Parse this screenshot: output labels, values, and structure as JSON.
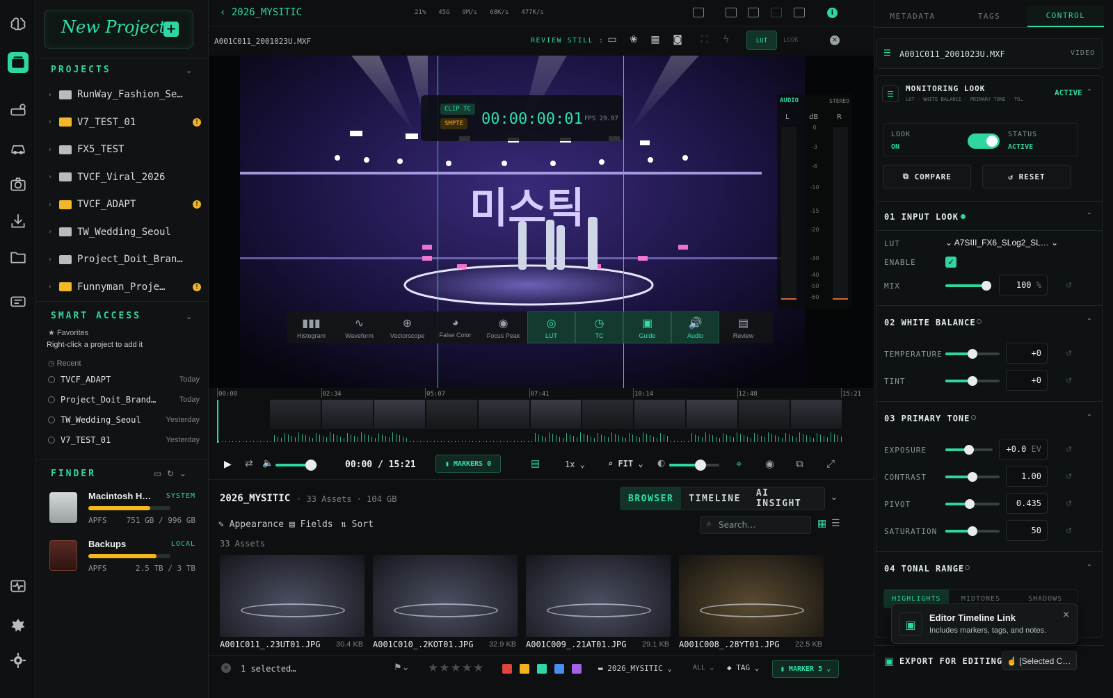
{
  "rail": {
    "icons": [
      "brain-icon",
      "stack-icon",
      "devices-icon",
      "car-icon",
      "camera-icon",
      "import-icon",
      "folder-question-icon",
      "chat-list-icon",
      "pulse-icon",
      "plugin-icon",
      "settings-icon"
    ]
  },
  "sidebar": {
    "new_project": "New Project",
    "projects_title": "PROJECTS",
    "projects": [
      {
        "name": "RunWay_Fashion_Se…",
        "color": "gray",
        "warn": false
      },
      {
        "name": "V7_TEST_01",
        "color": "yellow",
        "warn": true
      },
      {
        "name": "FX5_TEST",
        "color": "gray",
        "warn": false
      },
      {
        "name": "TVCF_Viral_2026",
        "color": "gray",
        "warn": false
      },
      {
        "name": "TVCF_ADAPT",
        "color": "yellow",
        "warn": true
      },
      {
        "name": "TW_Wedding_Seoul",
        "color": "gray",
        "warn": false
      },
      {
        "name": "Project_Doit_Bran…",
        "color": "gray",
        "warn": false
      },
      {
        "name": "Funnyman_Proje…",
        "color": "yellow",
        "warn": true
      }
    ],
    "warn_glyph": "!",
    "smart_title": "SMART ACCESS",
    "favorites": "Favorites",
    "favorites_hint": "Right-click a project to add it",
    "recent_title": "Recent",
    "recent": [
      {
        "name": "TVCF_ADAPT",
        "when": "Today"
      },
      {
        "name": "Project_Doit_Brand…",
        "when": "Today"
      },
      {
        "name": "TW_Wedding_Seoul",
        "when": "Yesterday"
      },
      {
        "name": "V7_TEST_01",
        "when": "Yesterday"
      }
    ],
    "finder_title": "FINDER",
    "disks": [
      {
        "name": "Macintosh H…",
        "tag": "SYSTEM",
        "fs": "APFS",
        "size": "751 GB / 996 GB",
        "fill": 0.754
      },
      {
        "name": "Backups",
        "tag": "LOCAL",
        "fs": "APFS",
        "size": "2.5 TB / 3 TB",
        "fill": 0.83
      }
    ]
  },
  "topbar": {
    "title": "2026_MYSITIC",
    "stats": [
      "21%",
      "45G",
      "9M/s",
      "68K/s",
      "477K/s"
    ]
  },
  "toolbar2": {
    "filename": "A001C011_2001023U.MXF",
    "review_still": "REVIEW STILL :",
    "lut": "LUT",
    "look": "LOOK"
  },
  "viewer": {
    "clip_tc": "CLIP TC",
    "smpte": "SMPTE",
    "timecode": "00:00:00:01",
    "fps": "FPS 29.97",
    "audio": "AUDIO",
    "stereo": "STEREO",
    "meter_l": "L",
    "meter_db": "dB",
    "meter_r": "R",
    "db_marks": [
      "0",
      "-3",
      "-6",
      "-10",
      "-15",
      "-20",
      "-30",
      "-40",
      "-50",
      "-60"
    ],
    "scopes": [
      {
        "label": "Histogram",
        "glyph": "▮▮▮",
        "on": false
      },
      {
        "label": "Waveform",
        "glyph": "∿",
        "on": false
      },
      {
        "label": "Vectorscope",
        "glyph": "⊕",
        "on": false
      },
      {
        "label": "False Color",
        "glyph": "◕",
        "on": false
      },
      {
        "label": "Focus Peak",
        "glyph": "◉",
        "on": false
      },
      {
        "label": "LUT",
        "glyph": "◎",
        "on": true
      },
      {
        "label": "TC",
        "glyph": "◷",
        "on": true
      },
      {
        "label": "Guide",
        "glyph": "▣",
        "on": true
      },
      {
        "label": "Audio",
        "glyph": "🔊",
        "on": true
      },
      {
        "label": "Review",
        "glyph": "▤",
        "on": false
      }
    ],
    "logo_text": "미스틱"
  },
  "timeline": {
    "marks": [
      "00:00",
      "02:34",
      "05:07",
      "07:41",
      "10:14",
      "12:48",
      "15:21"
    ]
  },
  "transport": {
    "time": "00:00 / 15:21",
    "markers": "MARKERS 0",
    "speed": "1x",
    "fit": "FIT",
    "volume": 0.85,
    "brightness": 0.62
  },
  "browser": {
    "project": "2026_MYSITIC",
    "counts": "· 33 Assets · 104 GB",
    "tabs": [
      "BROWSER",
      "TIMELINE",
      "AI INSIGHT"
    ],
    "appearance": "Appearance",
    "fields": "Fields",
    "sort": "Sort",
    "search_placeholder": "Search…",
    "asset_count": "33 Assets",
    "assets": [
      {
        "name": "A001C011_.23UT01.JPG",
        "size": "30.4 KB"
      },
      {
        "name": "A001C010_.2KOT01.JPG",
        "size": "32.9 KB"
      },
      {
        "name": "A001C009_.21AT01.JPG",
        "size": "29.1 KB"
      },
      {
        "name": "A001C008_.28YT01.JPG",
        "size": "22.5 KB"
      }
    ],
    "selected": "1 selected…",
    "stars": "★★★★★",
    "colors": [
      "#e0453d",
      "#f2b31d",
      "#2fd6a3",
      "#4a8cf0",
      "#a262e8"
    ],
    "folder": "2026_MYSITIC",
    "all": "ALL",
    "tag": "TAG",
    "marker": "MARKER 5"
  },
  "right": {
    "tabs": [
      "METADATA",
      "TAGS",
      "CONTROL"
    ],
    "file": "A001C011_2001023U.MXF",
    "file_type": "VIDEO",
    "monitoring": "MONITORING LOOK",
    "monitoring_sub": "LUT · WHITE BALANCE · PRIMARY TONE · TO…",
    "active": "ACTIVE",
    "look_lbl": "LOOK",
    "look_val": "ON",
    "status_lbl": "STATUS",
    "status_val": "ACTIVE",
    "compare": "COMPARE",
    "reset": "RESET",
    "input_look": "01 INPUT LOOK",
    "lut_lbl": "LUT",
    "lut_val": "A7SIII_FX6_SLog2_SL…",
    "enable_lbl": "ENABLE",
    "mix_lbl": "MIX",
    "mix_val": "100",
    "mix_unit": "%",
    "mix_pct": 1.0,
    "wb": "02 WHITE BALANCE",
    "temp_lbl": "TEMPERATURE",
    "temp_val": "+0",
    "tint_lbl": "TINT",
    "tint_val": "+0",
    "primary": "03 PRIMARY TONE",
    "exposure_lbl": "EXPOSURE",
    "exposure_val": "+0.0",
    "exposure_unit": "EV",
    "contrast_lbl": "CONTRAST",
    "contrast_val": "1.00",
    "pivot_lbl": "PIVOT",
    "pivot_val": "0.435",
    "saturation_lbl": "SATURATION",
    "saturation_val": "50",
    "tonal": "04 TONAL RANGE",
    "ranges": [
      "HIGHLIGHTS",
      "MIDTONES",
      "SHADOWS"
    ],
    "toast_title": "Editor Timeline Link",
    "toast_sub": "Includes markers, tags, and notes.",
    "export": "EXPORT FOR EDITING",
    "export_sel": "[Selected C…"
  }
}
